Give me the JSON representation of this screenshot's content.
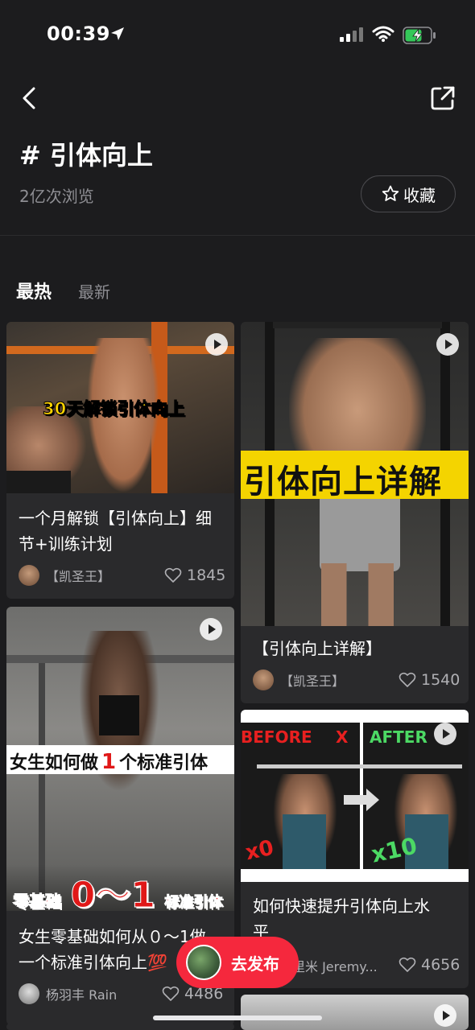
{
  "status_bar": {
    "time": "00:39"
  },
  "topic": {
    "title": "# 引体向上",
    "views": "2亿次浏览",
    "collect_label": "收藏"
  },
  "tabs": {
    "hot": "最热",
    "new": "最新"
  },
  "cards": [
    {
      "overlay": "30天解锁引体向上",
      "title_line1": "一个月解锁【引体向上】细",
      "title_line2": "节+训练计划",
      "author": "【凯圣王】",
      "likes": "1845"
    },
    {
      "overlay": "引体向上详解",
      "title_line1": "【引体向上详解】",
      "author": "【凯圣王】",
      "likes": "1540"
    },
    {
      "overlay_top_a": "女生如何做",
      "overlay_top_num": "1",
      "overlay_top_b": "个标准引体",
      "overlay_bottom_a": "零基础",
      "overlay_bottom_b": "0～1",
      "overlay_bottom_c": "标准引体",
      "title_line1": "女生零基础如何从０～1做",
      "title_line2": "一个标准引体向上💯",
      "author": "杨羽丰 Rain",
      "likes": "4486"
    },
    {
      "before": "BEFORE",
      "after": "AFTER",
      "x_mark": "X",
      "x0": "x0",
      "x10": "x10",
      "title_line1": "如何快速提升引体向上水",
      "title_line2": "平",
      "author": "里米 Jeremy...",
      "likes": "4656"
    }
  ],
  "fab": {
    "label": "去发布"
  },
  "colors": {
    "accent": "#f5283d",
    "background": "#1c1c1e",
    "card": "#2a2a2c"
  }
}
